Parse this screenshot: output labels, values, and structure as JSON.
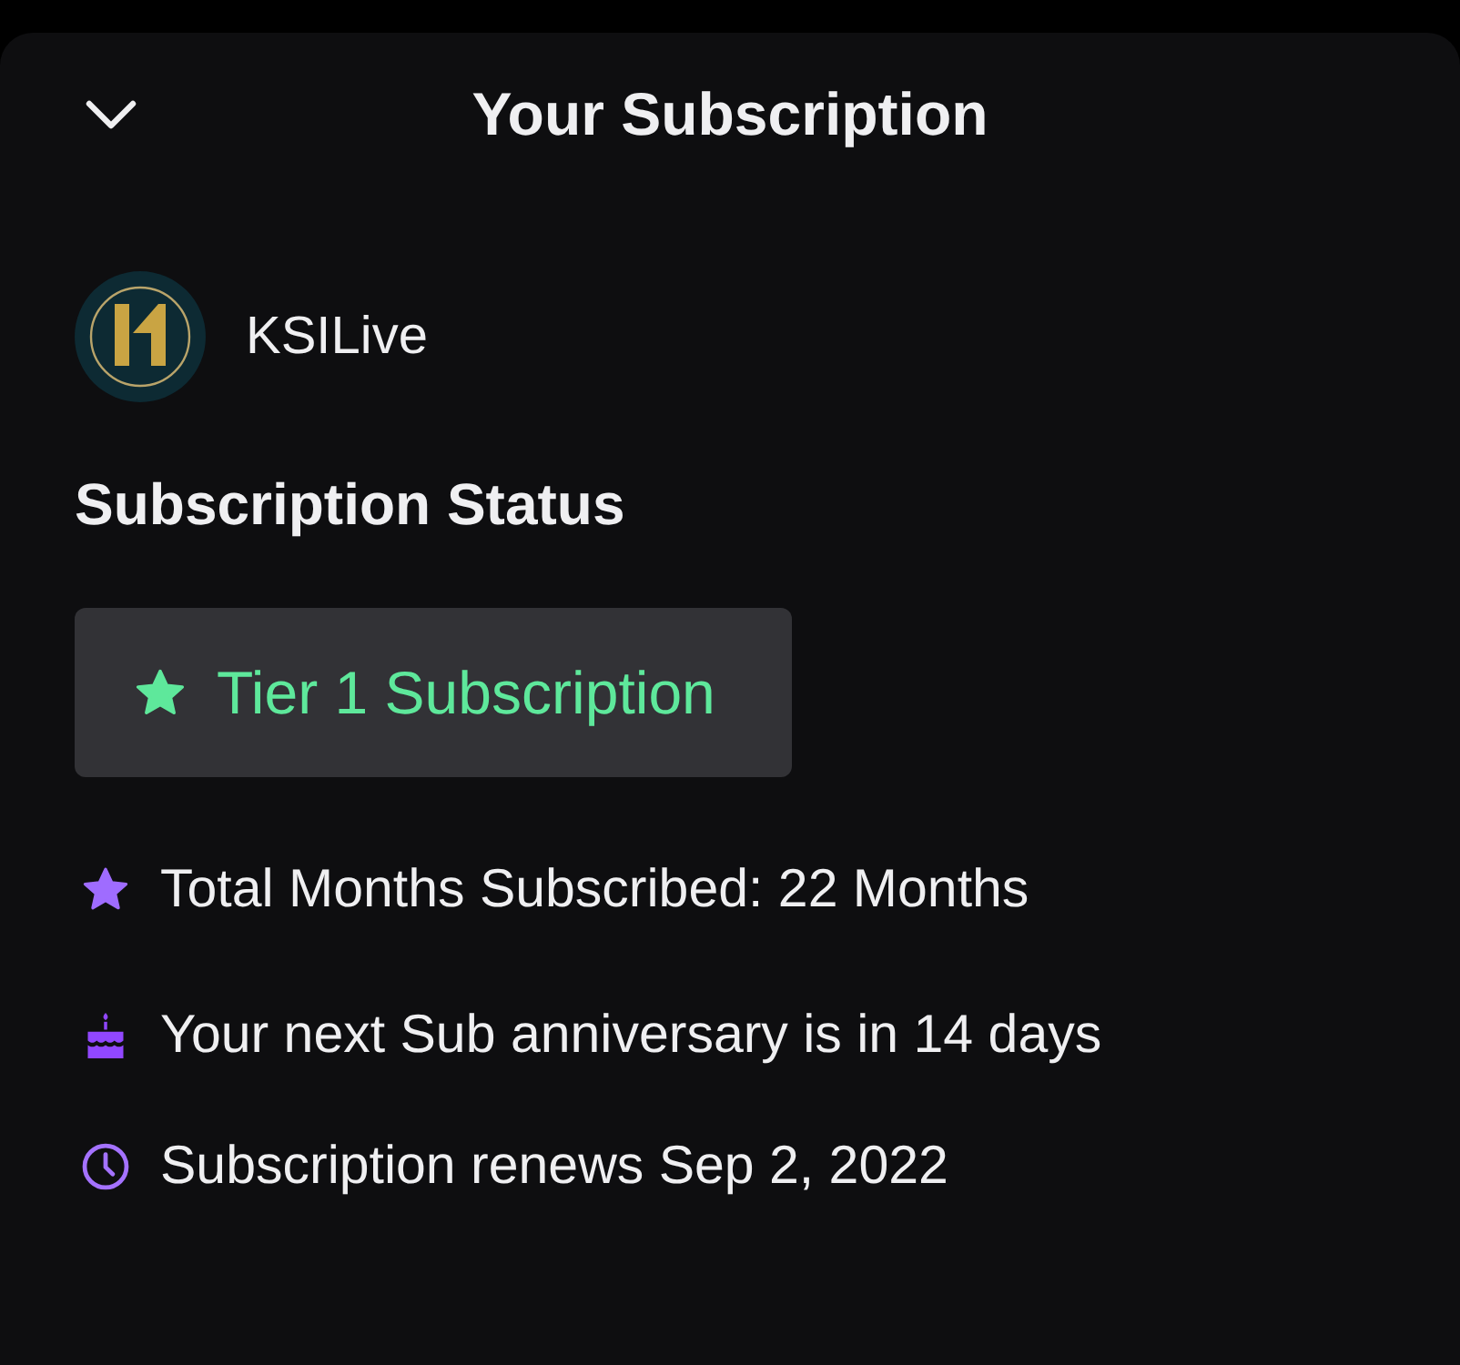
{
  "header": {
    "title": "Your Subscription"
  },
  "channel": {
    "name": "KSILive"
  },
  "status": {
    "heading": "Subscription Status",
    "tier": {
      "label": "Tier 1 Subscription"
    }
  },
  "details": [
    {
      "kind": "star",
      "text": "Total Months Subscribed: 22 Months"
    },
    {
      "kind": "cake",
      "text": "Your next Sub anniversary is in 14 days"
    },
    {
      "kind": "clock",
      "text": "Subscription renews Sep 2, 2022"
    }
  ]
}
